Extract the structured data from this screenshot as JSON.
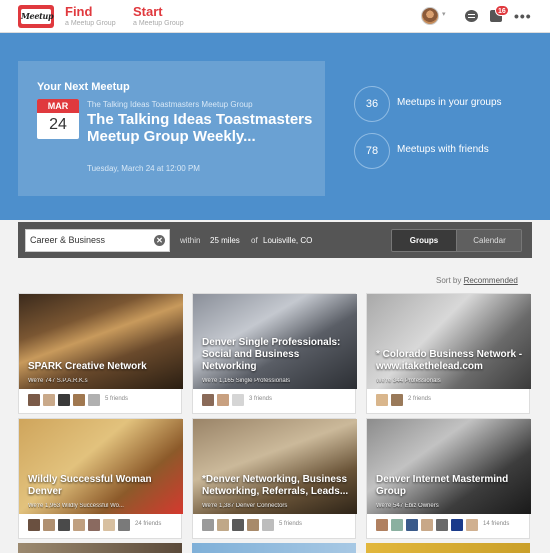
{
  "header": {
    "logo_text": "Meetup",
    "find_label": "Find",
    "find_sub": "a Meetup Group",
    "start_label": "Start",
    "start_sub": "a Meetup Group",
    "notification_count": "16",
    "more_label": "•••",
    "avatar_caret": "▾"
  },
  "next_meetup": {
    "heading": "Your Next Meetup",
    "month": "MAR",
    "day": "24",
    "group": "The Talking Ideas Toastmasters Meetup Group",
    "title": "The Talking Ideas Toastmasters Meetup Group Weekly...",
    "datetime": "Tuesday, March 24 at 12:00 PM"
  },
  "stats": [
    {
      "count": "36",
      "label": "Meetups in your groups"
    },
    {
      "count": "78",
      "label": "Meetups with friends"
    }
  ],
  "search": {
    "value": "Career & Business",
    "clear_icon": "✕",
    "within": "within",
    "miles": "25 miles",
    "of": "of",
    "location": "Louisville, CO",
    "view_groups": "Groups",
    "view_calendar": "Calendar"
  },
  "sort": {
    "label": "Sort by",
    "value": "Recommended"
  },
  "groups": [
    {
      "name": "SPARK Creative Network",
      "members": "We're 747 S.P.A.R.K.s",
      "friends": "5 friends",
      "avatars": [
        "#7a5a48",
        "#c9a98a",
        "#3a3a3a",
        "#a07850",
        "#b0b0b0"
      ]
    },
    {
      "name": "Denver Single Professionals: Social and Business Networking",
      "members": "We're 1,165 Single Professionals",
      "friends": "3 friends",
      "avatars": [
        "#8a6a58",
        "#c8a080",
        "#d5d5d5"
      ]
    },
    {
      "name": "* Colorado Business Network - www.itakethelead.com",
      "members": "We're 344 Professionals",
      "friends": "2 friends",
      "avatars": [
        "#d9b68c",
        "#9a7a5a"
      ]
    },
    {
      "name": "Wildly Successful Woman Denver",
      "members": "We're 1,963 Wildly Successful Wo...",
      "friends": "24 friends",
      "avatars": [
        "#6a5040",
        "#b09070",
        "#4a4a4a",
        "#c0a080",
        "#8a6a60",
        "#d8c0a0",
        "#7a7a7a"
      ]
    },
    {
      "name": "*Denver Networking, Business Networking, Referrals, Leads...",
      "members": "We're 1,387 Denver Connectors",
      "friends": "5 friends",
      "avatars": [
        "#9a9a9a",
        "#c0a888",
        "#5a5a5a",
        "#a88a6a",
        "#bdbdbd"
      ]
    },
    {
      "name": "Denver Internet Mastermind Group",
      "members": "We're 547 Ebiz Owners",
      "friends": "14 friends",
      "avatars": [
        "#b08060",
        "#8ab0a0",
        "#3a5a8a",
        "#c8a888",
        "#6a6a6a",
        "#1a3a8a",
        "#d0b090"
      ]
    }
  ]
}
